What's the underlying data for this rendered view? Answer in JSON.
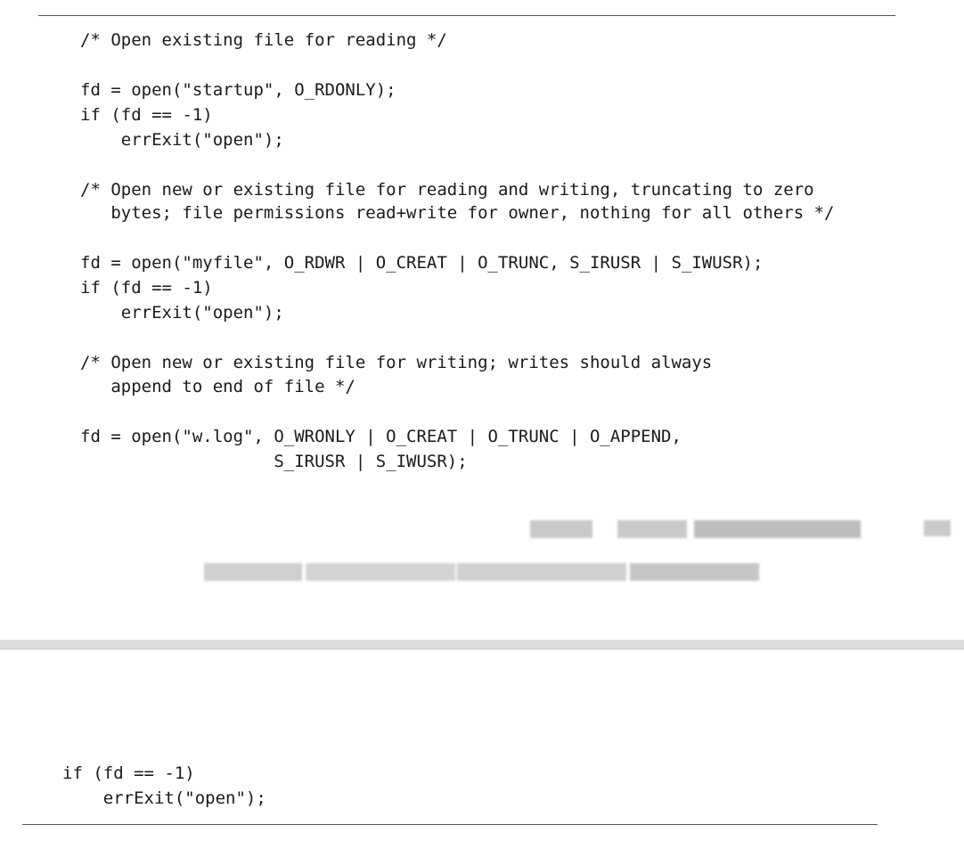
{
  "page1": {
    "code_lines": [
      "/* Open existing file for reading */",
      "fd = open(\"startup\", O_RDONLY);",
      "if (fd == -1)",
      "    errExit(\"open\");",
      "/* Open new or existing file for reading and writing, truncating to zero",
      "   bytes; file permissions read+write for owner, nothing for all others */",
      "fd = open(\"myfile\", O_RDWR | O_CREAT | O_TRUNC, S_IRUSR | S_IWUSR);",
      "if (fd == -1)",
      "    errExit(\"open\");",
      "/* Open new or existing file for writing; writes should always",
      "   append to end of file */",
      "fd = open(\"w.log\", O_WRONLY | O_CREAT | O_TRUNC | O_APPEND,",
      "                   S_IRUSR | S_IWUSR);"
    ]
  },
  "page2": {
    "code_lines": [
      "if (fd == -1)",
      "    errExit(\"open\");"
    ]
  }
}
